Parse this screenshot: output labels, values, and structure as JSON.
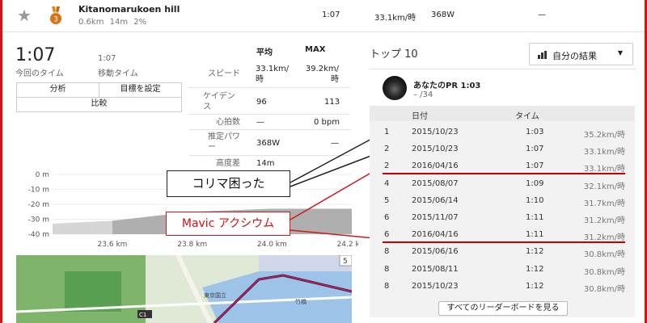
{
  "header": {
    "segment_name": "Kitanomarukoen hill",
    "distance": "0.6km",
    "elevation": "14m",
    "grade": "2%",
    "time": "1:07",
    "speed": "33.1km/時",
    "power": "368W",
    "dash": "—",
    "medal_number": "3"
  },
  "left": {
    "current_time": "1:07",
    "current_time_label": "今回のタイム",
    "moving_time": "1:07",
    "moving_time_label": "移動タイム",
    "buttons": {
      "analysis": "分析",
      "set_goal": "目標を設定",
      "compare": "比較"
    }
  },
  "stats": {
    "col_avg": "平均",
    "col_max": "MAX",
    "rows": [
      {
        "label": "スピード",
        "avg": "33.1km/時",
        "max": "39.2km/時"
      },
      {
        "label": "ケイデンス",
        "avg": "96",
        "max": "113"
      },
      {
        "label": "心拍数",
        "avg": "—",
        "max": "0 bpm"
      },
      {
        "label": "推定パワー",
        "avg": "368W",
        "max": "—"
      },
      {
        "label": "高度差",
        "avg": "14m",
        "max": ""
      }
    ]
  },
  "chart_data": {
    "type": "area",
    "yticks": [
      "0 m",
      "-10 m",
      "-20 m",
      "-30 m",
      "-40 m"
    ],
    "xticks": [
      "23.6 km",
      "23.8 km",
      "24.0 km",
      "24.2 km"
    ],
    "ylim": [
      -40,
      0
    ],
    "x": [
      23.45,
      23.6,
      23.7,
      23.8,
      23.9,
      24.0,
      24.1,
      24.2
    ],
    "y": [
      -33,
      -31,
      -28,
      -25,
      -24,
      -23,
      -23,
      -23
    ],
    "segment_range": [
      23.6,
      24.2
    ]
  },
  "map": {
    "labels": [
      "東京国立",
      "竹橋",
      "C1"
    ],
    "zoom_in": "+",
    "zoom_out": "5"
  },
  "callouts": {
    "black": "コリマ困った",
    "red": "Mavic アクシウム"
  },
  "right": {
    "title": "トップ 10",
    "results_button": "自分の結果",
    "pr_title": "あなたのPR 1:03",
    "pr_sub": "– /34",
    "col_date": "日付",
    "col_time": "タイム",
    "rows": [
      {
        "rank": "1",
        "date": "2015/10/23",
        "time": "1:03",
        "speed": "35.2km/時"
      },
      {
        "rank": "2",
        "date": "2015/10/23",
        "time": "1:07",
        "speed": "33.1km/時"
      },
      {
        "rank": "2",
        "date": "2016/04/16",
        "time": "1:07",
        "speed": "33.1km/時"
      },
      {
        "rank": "4",
        "date": "2015/08/07",
        "time": "1:09",
        "speed": "32.1km/時"
      },
      {
        "rank": "5",
        "date": "2015/06/14",
        "time": "1:10",
        "speed": "31.7km/時"
      },
      {
        "rank": "6",
        "date": "2015/11/07",
        "time": "1:11",
        "speed": "31.2km/時"
      },
      {
        "rank": "6",
        "date": "2016/04/16",
        "time": "1:11",
        "speed": "31.2km/時"
      },
      {
        "rank": "8",
        "date": "2015/06/16",
        "time": "1:12",
        "speed": "30.8km/時"
      },
      {
        "rank": "8",
        "date": "2015/08/11",
        "time": "1:12",
        "speed": "30.8km/時"
      },
      {
        "rank": "8",
        "date": "2015/10/23",
        "time": "1:12",
        "speed": "30.8km/時"
      }
    ],
    "footer_button": "すべてのリーダーボードを見る"
  }
}
